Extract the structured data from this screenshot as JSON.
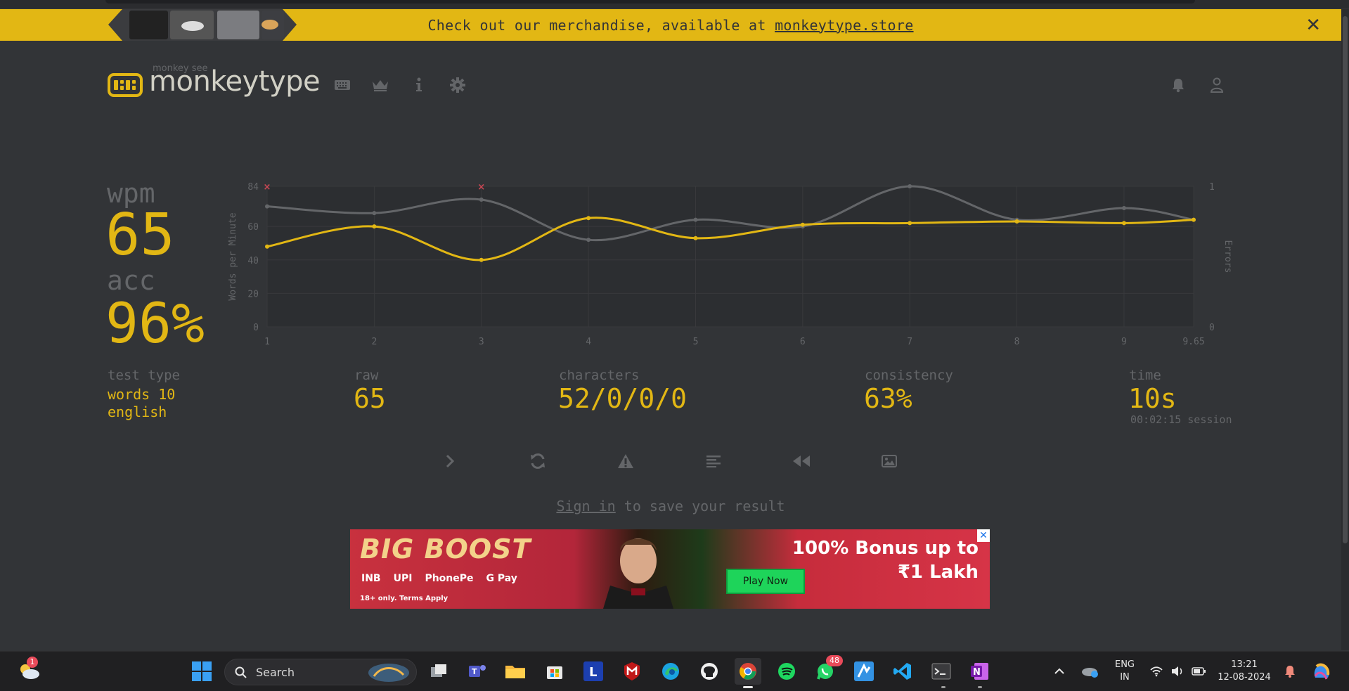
{
  "banner": {
    "text": "Check out our merchandise, available at ",
    "link": "monkeytype.store",
    "close": "✕"
  },
  "header": {
    "logo_small": "monkey see",
    "logo_text": "monkeytype",
    "nav_icons": [
      "keyboard-icon",
      "crown-icon",
      "info-icon",
      "gear-icon"
    ],
    "right_icons": [
      "bell-icon",
      "user-icon"
    ]
  },
  "result": {
    "wpm_label": "wpm",
    "wpm": "65",
    "acc_label": "acc",
    "acc": "96%",
    "test_type_label": "test type",
    "test_type_mode": "words 10",
    "test_type_language": "english",
    "raw_label": "raw",
    "raw": "65",
    "characters_label": "characters",
    "characters": "52/0/0/0",
    "consistency_label": "consistency",
    "consistency": "63%",
    "time_label": "time",
    "time": "10s",
    "session": "00:02:15 session"
  },
  "chart_data": {
    "type": "line",
    "x": [
      1,
      2,
      3,
      4,
      5,
      6,
      7,
      8,
      9,
      9.65
    ],
    "x_tick_labels": [
      "1",
      "2",
      "3",
      "4",
      "5",
      "6",
      "7",
      "8",
      "9",
      "9.65"
    ],
    "ylabel": "Words per Minute",
    "y2label": "Errors",
    "y_ticks": [
      "0",
      "20",
      "40",
      "60",
      "84"
    ],
    "y2_ticks": [
      "0",
      "1"
    ],
    "ylim": [
      0,
      84
    ],
    "y2lim": [
      0,
      1
    ],
    "series": [
      {
        "color": "#e2b714",
        "values": [
          48,
          60,
          40,
          65,
          53,
          61,
          62,
          63,
          62,
          64
        ]
      },
      {
        "color": "#646669",
        "values": [
          72,
          68,
          76,
          52,
          64,
          60,
          84,
          64,
          71,
          64
        ]
      }
    ],
    "errors": [
      {
        "x": 1,
        "value": 1
      },
      {
        "x": 3,
        "value": 1
      }
    ],
    "grid": true
  },
  "actions": [
    "next-test",
    "restart-test",
    "report-issue",
    "words-history",
    "watch-replay",
    "save-screenshot"
  ],
  "signin": {
    "link": "Sign in",
    "text": " to save your result"
  },
  "ad": {
    "title": "BIG BOOST",
    "pays": [
      "INB",
      "UPI",
      "PhonePe",
      "G Pay"
    ],
    "terms": "18+ only. Terms Apply",
    "play": "Play Now",
    "bonus_line1": "100% Bonus up to",
    "bonus_line2": "₹1 Lakh",
    "close": "✕"
  },
  "taskbar": {
    "search": "Search",
    "weather_badge": "1",
    "whatsapp_badge": "48",
    "lang_line1": "ENG",
    "lang_line2": "IN",
    "time": "13:21",
    "date": "12-08-2024"
  },
  "colors": {
    "background": "#323437",
    "main": "#e2b714",
    "sub": "#646669",
    "text": "#d1d0c5",
    "error": "#ca4754"
  }
}
